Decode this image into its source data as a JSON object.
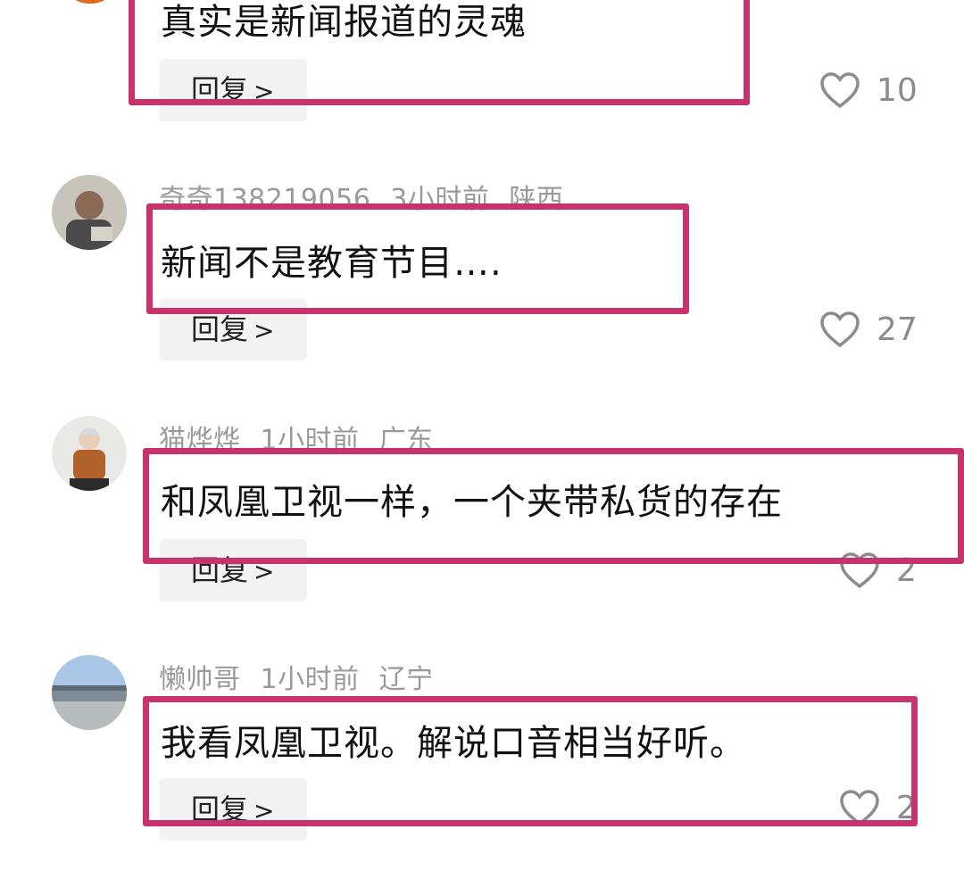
{
  "comments": [
    {
      "user": "",
      "time": "",
      "region": "",
      "text": "真实是新闻报道的灵魂",
      "reply_label": "回复",
      "likes": "10"
    },
    {
      "user": "奇奇138219056",
      "time": "3小时前",
      "region": "陕西",
      "text": "新闻不是教育节目….",
      "reply_label": "回复",
      "likes": "27"
    },
    {
      "user": "猫烨烨",
      "time": "1小时前",
      "region": "广东",
      "text": "和凤凰卫视一样，一个夹带私货的存在",
      "reply_label": "回复",
      "likes": "2"
    },
    {
      "user": "懒帅哥",
      "time": "1小时前",
      "region": "辽宁",
      "text": "我看凤凰卫视。解说口音相当好听。",
      "reply_label": "回复",
      "likes": "2"
    }
  ],
  "icons": {
    "like": "heart-outline-icon",
    "chevron": "chevron-right-icon"
  },
  "colors": {
    "highlight": "#c8336e",
    "meta": "#9a9a9a"
  }
}
